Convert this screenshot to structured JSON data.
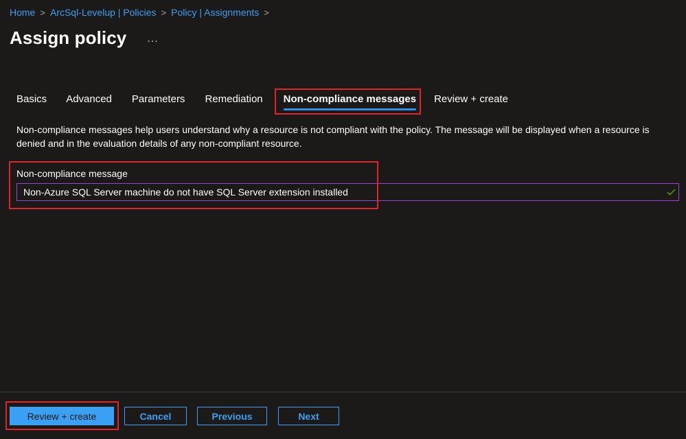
{
  "breadcrumb": {
    "items": [
      "Home",
      "ArcSql-Levelup | Policies",
      "Policy | Assignments"
    ],
    "separator": ">"
  },
  "page": {
    "title": "Assign policy",
    "more": "..."
  },
  "tabs": [
    {
      "label": "Basics"
    },
    {
      "label": "Advanced"
    },
    {
      "label": "Parameters"
    },
    {
      "label": "Remediation"
    },
    {
      "label": "Non-compliance messages",
      "active": true
    },
    {
      "label": "Review + create"
    }
  ],
  "description": "Non-compliance messages help users understand why a resource is not compliant with the policy. The message will be displayed when a resource is denied and in the evaluation details of any non-compliant resource.",
  "field": {
    "label": "Non-compliance message",
    "value": "Non-Azure SQL Server machine do not have SQL Server extension installed",
    "valid_icon": "check-icon"
  },
  "footer": {
    "review_create": "Review + create",
    "cancel": "Cancel",
    "previous": "Previous",
    "next": "Next"
  },
  "colors": {
    "background": "#1b1a19",
    "accent": "#3aa0f3",
    "highlight": "#e1262b",
    "input_border": "#9a41d6",
    "valid": "#57a300"
  }
}
